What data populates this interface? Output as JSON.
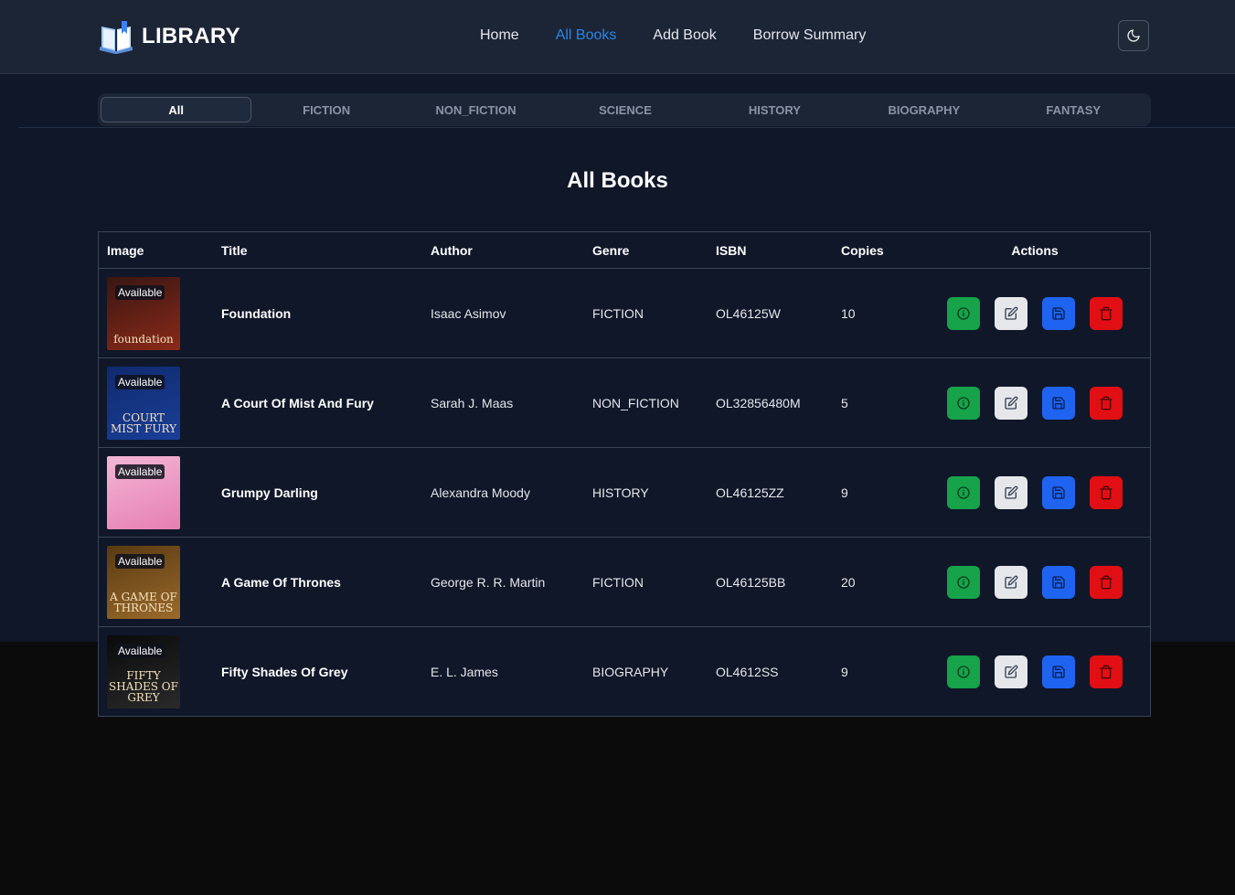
{
  "header": {
    "brand": "LIBRARY",
    "nav": [
      {
        "label": "Home",
        "active": false
      },
      {
        "label": "All Books",
        "active": true
      },
      {
        "label": "Add Book",
        "active": false
      },
      {
        "label": "Borrow Summary",
        "active": false
      }
    ],
    "theme_icon": "moon-icon"
  },
  "tabs": [
    "All",
    "FICTION",
    "NON_FICTION",
    "SCIENCE",
    "HISTORY",
    "BIOGRAPHY",
    "FANTASY"
  ],
  "active_tab": "All",
  "page_title": "All Books",
  "table": {
    "columns": [
      "Image",
      "Title",
      "Author",
      "Genre",
      "ISBN",
      "Copies",
      "Actions"
    ],
    "rows": [
      {
        "badge": "Available",
        "cover_text": "foundation",
        "cover_colors": [
          "#3a1612",
          "#8a2a18"
        ],
        "title": "Foundation",
        "author": "Isaac Asimov",
        "genre": "FICTION",
        "isbn": "OL46125W",
        "copies": "10"
      },
      {
        "badge": "Available",
        "cover_text": "COURT MIST FURY",
        "cover_colors": [
          "#0f2a6e",
          "#1a3f98"
        ],
        "title": "A Court Of Mist And Fury",
        "author": "Sarah J. Maas",
        "genre": "NON_FICTION",
        "isbn": "OL32856480M",
        "copies": "5"
      },
      {
        "badge": "Available",
        "cover_text": "",
        "cover_colors": [
          "#f3b6d5",
          "#e67fb2"
        ],
        "title": "Grumpy Darling",
        "author": "Alexandra Moody",
        "genre": "HISTORY",
        "isbn": "OL46125ZZ",
        "copies": "9"
      },
      {
        "badge": "Available",
        "cover_text": "A GAME OF THRONES",
        "cover_colors": [
          "#5a3a12",
          "#9a6a2a"
        ],
        "title": "A Game Of Thrones",
        "author": "George R. R. Martin",
        "genre": "FICTION",
        "isbn": "OL46125BB",
        "copies": "20"
      },
      {
        "badge": "Available",
        "cover_text": "FIFTY SHADES OF GREY",
        "cover_colors": [
          "#0a0a0a",
          "#2a2a2a"
        ],
        "title": "Fifty Shades Of Grey",
        "author": "E. L. James",
        "genre": "BIOGRAPHY",
        "isbn": "OL4612SS",
        "copies": "9"
      }
    ],
    "action_icons": [
      "info-icon",
      "edit-icon",
      "save-icon",
      "trash-icon"
    ]
  },
  "colors": {
    "accent": "#2a86e6",
    "info": "#16a34a",
    "edit": "#e5e7eb",
    "save": "#1f64f0",
    "delete": "#e10f14"
  }
}
